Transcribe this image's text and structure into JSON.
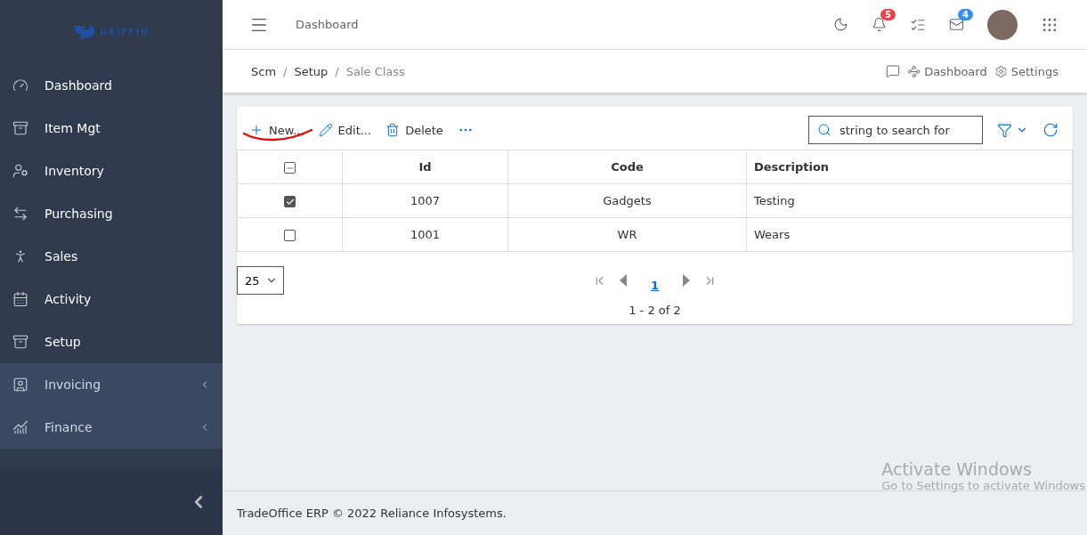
{
  "sidebar": {
    "logo": "GRIFFIN",
    "items": [
      {
        "label": "Dashboard",
        "expandable": false
      },
      {
        "label": "Item Mgt",
        "expandable": false
      },
      {
        "label": "Inventory",
        "expandable": false
      },
      {
        "label": "Purchasing",
        "expandable": false
      },
      {
        "label": "Sales",
        "expandable": false
      },
      {
        "label": "Activity",
        "expandable": false
      },
      {
        "label": "Setup",
        "expandable": false
      },
      {
        "label": "Invoicing",
        "expandable": true
      },
      {
        "label": "Finance",
        "expandable": true
      }
    ]
  },
  "header": {
    "title": "Dashboard",
    "notifications": "5",
    "messages": "4"
  },
  "breadcrumb": {
    "items": [
      "Scm",
      "Setup",
      "Sale Class"
    ],
    "separators": [
      "/",
      "/"
    ],
    "links": [
      "Dashboard",
      "Settings"
    ]
  },
  "toolbar": {
    "buttons": [
      {
        "label": "New...",
        "kind": "new"
      },
      {
        "label": "Edit...",
        "kind": "edit"
      },
      {
        "label": "Delete",
        "kind": "delete"
      }
    ],
    "search": {
      "placeholder": "string to search for"
    }
  },
  "table": {
    "header_checkbox": {
      "indeterminate": true
    },
    "columns": [
      "Id",
      "Code",
      "Description"
    ],
    "rows": [
      {
        "checked": true,
        "cells": [
          "1007",
          "Gadgets",
          "Testing"
        ]
      },
      {
        "checked": false,
        "cells": [
          "1001",
          "WR",
          "Wears"
        ]
      }
    ]
  },
  "pager": {
    "page_size": "25",
    "pages": [
      {
        "label": "1",
        "selected": true
      }
    ],
    "summary": "1 - 2 of 2"
  },
  "footer": "TradeOffice ERP © 2022 Reliance Infosystems.",
  "os_notice": {
    "title": "Activate Windows",
    "text": "Go to Settings to activate Windows"
  }
}
